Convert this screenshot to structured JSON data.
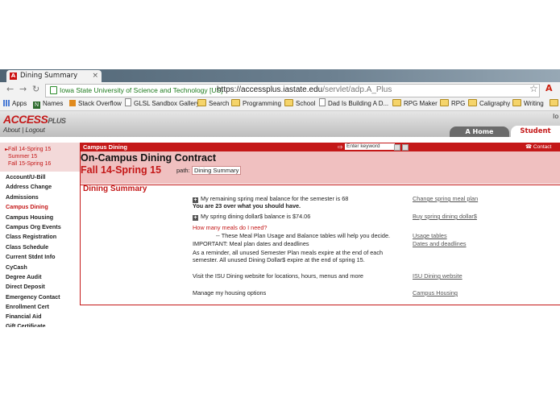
{
  "browser": {
    "tab_title": "Dining Summary",
    "tab_close": "×",
    "ev_label": "Iowa State University of Science and Technology [US]",
    "url_host": "https://accessplus.iastate.edu",
    "url_path": "/servlet/adp.A_Plus",
    "bookmarks": [
      "Apps",
      "Names",
      "Stack Overflow",
      "GLSL Sandbox Gallery",
      "Search",
      "Programming",
      "School",
      "Dad Is Building A D...",
      "RPG Maker",
      "RPG",
      "Caligraphy",
      "Writing"
    ]
  },
  "site": {
    "logo_main": "ACCESS",
    "logo_plus": "PLUS",
    "about": "About",
    "logout": "Logout",
    "right_edge": "Io",
    "home_tab": "Home",
    "student_tab": "Student"
  },
  "terms": [
    "Fall 14-Spring 15",
    "Summer 15",
    "Fall 15-Spring 16"
  ],
  "left_nav": [
    "Account/U-Bill",
    "Address Change",
    "Admissions",
    "Campus Dining",
    "Campus Housing",
    "Campus Org Events",
    "Class Registration",
    "Class Schedule",
    "Current Stdnt Info",
    "CyCash",
    "Degree Audit",
    "Direct Deposit",
    "Emergency Contact",
    "Enrollment Cert",
    "Financial Aid",
    "Gift Certificate"
  ],
  "active_nav": "Campus Dining",
  "header": {
    "breadcrumb": "Campus Dining",
    "keyword_placeholder": "Enter keyword",
    "contact": "Contact",
    "title": "On-Campus Dining Contract",
    "term": "Fall 14-Spring 15",
    "path_label": "path:",
    "path_value": "Dining Summary"
  },
  "summary": {
    "heading": "Dining Summary",
    "meal_balance": "My remaining spring meal balance for the semester is 68",
    "over_note": "You are 23 over what you should have.",
    "dining_balance": "My spring dining dollar$ balance is $74.06",
    "how_many": "How many meals do I need?",
    "tables_note": "-- These Meal Plan Usage and Balance tables will help you decide.",
    "important": "IMPORTANT: Meal plan dates and deadlines",
    "reminder_1": "As a reminder, all unused Semester Plan meals expire at the end of each",
    "reminder_2": "semester. All unused Dining Dollar$ expire at the end of spring 15.",
    "visit": "Visit the ISU Dining website for locations, hours, menus and more",
    "housing": "Manage my housing options",
    "links": {
      "change_plan": "Change spring meal plan",
      "buy_dollars": "Buy spring dining dollar$",
      "usage_tables": "Usage tables",
      "dates": "Dates and deadlines",
      "dining_site": "ISU Dining website",
      "campus_housing": "Campus Housing"
    }
  }
}
